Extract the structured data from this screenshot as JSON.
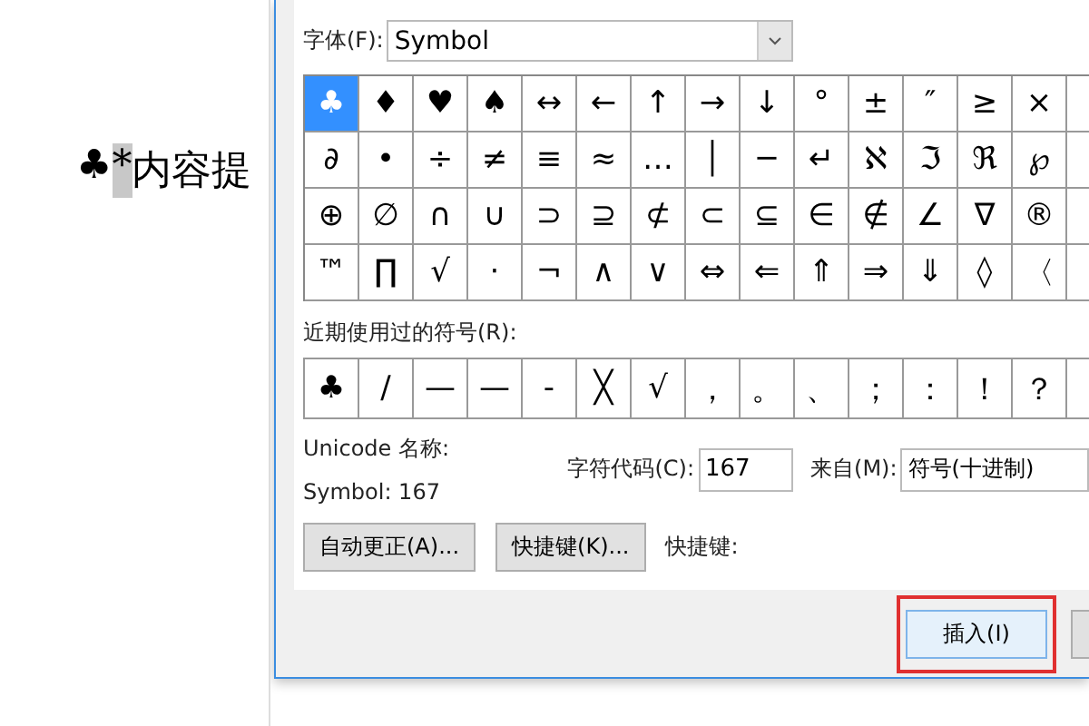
{
  "document": {
    "segments": [
      {
        "text": "♣",
        "selected": false
      },
      {
        "text": "*",
        "selected": true
      },
      {
        "text": "内容提",
        "selected": false
      }
    ]
  },
  "dialog": {
    "font": {
      "label": "字体(F):",
      "value": "Symbol"
    },
    "symbols": [
      [
        {
          "char": "♣",
          "selected": true
        },
        {
          "char": "♦",
          "selected": false
        },
        {
          "char": "♥",
          "selected": false
        },
        {
          "char": "♠",
          "selected": false
        },
        {
          "char": "↔",
          "selected": false
        },
        {
          "char": "←",
          "selected": false
        },
        {
          "char": "↑",
          "selected": false
        },
        {
          "char": "→",
          "selected": false
        },
        {
          "char": "↓",
          "selected": false
        },
        {
          "char": "°",
          "selected": false
        },
        {
          "char": "±",
          "selected": false
        },
        {
          "char": "″",
          "selected": false
        },
        {
          "char": "≥",
          "selected": false
        },
        {
          "char": "×",
          "selected": false
        }
      ],
      [
        {
          "char": "∂",
          "selected": false
        },
        {
          "char": "•",
          "selected": false
        },
        {
          "char": "÷",
          "selected": false
        },
        {
          "char": "≠",
          "selected": false
        },
        {
          "char": "≡",
          "selected": false
        },
        {
          "char": "≈",
          "selected": false
        },
        {
          "char": "…",
          "selected": false
        },
        {
          "char": "│",
          "selected": false
        },
        {
          "char": "─",
          "selected": false
        },
        {
          "char": "↵",
          "selected": false
        },
        {
          "char": "ℵ",
          "selected": false
        },
        {
          "char": "ℑ",
          "selected": false
        },
        {
          "char": "ℜ",
          "selected": false
        },
        {
          "char": "℘",
          "selected": false
        }
      ],
      [
        {
          "char": "⊕",
          "selected": false
        },
        {
          "char": "∅",
          "selected": false
        },
        {
          "char": "∩",
          "selected": false
        },
        {
          "char": "∪",
          "selected": false
        },
        {
          "char": "⊃",
          "selected": false
        },
        {
          "char": "⊇",
          "selected": false
        },
        {
          "char": "⊄",
          "selected": false
        },
        {
          "char": "⊂",
          "selected": false
        },
        {
          "char": "⊆",
          "selected": false
        },
        {
          "char": "∈",
          "selected": false
        },
        {
          "char": "∉",
          "selected": false
        },
        {
          "char": "∠",
          "selected": false
        },
        {
          "char": "∇",
          "selected": false
        },
        {
          "char": "®",
          "selected": false
        }
      ],
      [
        {
          "char": "™",
          "selected": false
        },
        {
          "char": "∏",
          "selected": false
        },
        {
          "char": "√",
          "selected": false
        },
        {
          "char": "·",
          "selected": false
        },
        {
          "char": "¬",
          "selected": false
        },
        {
          "char": "∧",
          "selected": false
        },
        {
          "char": "∨",
          "selected": false
        },
        {
          "char": "⇔",
          "selected": false
        },
        {
          "char": "⇐",
          "selected": false
        },
        {
          "char": "⇑",
          "selected": false
        },
        {
          "char": "⇒",
          "selected": false
        },
        {
          "char": "⇓",
          "selected": false
        },
        {
          "char": "◊",
          "selected": false
        },
        {
          "char": "〈",
          "selected": false
        }
      ]
    ],
    "recent_label": "近期使用过的符号(R):",
    "recent": [
      "♣",
      "/",
      "—",
      "—",
      "-",
      "╳",
      "√",
      "，",
      "。",
      "、",
      "；",
      "：",
      "！",
      "？"
    ],
    "unicode_name_label": "Unicode 名称:",
    "unicode_name": "Symbol: 167",
    "char_code": {
      "label": "字符代码(C):",
      "value": "167"
    },
    "from": {
      "label": "来自(M):",
      "value": "符号(十进制)"
    },
    "autocorrect_button": "自动更正(A)...",
    "shortcut_button": "快捷键(K)...",
    "shortcut_label": "快捷键:",
    "insert_button": {
      "label": "插入(I)",
      "highlighted": true
    }
  }
}
